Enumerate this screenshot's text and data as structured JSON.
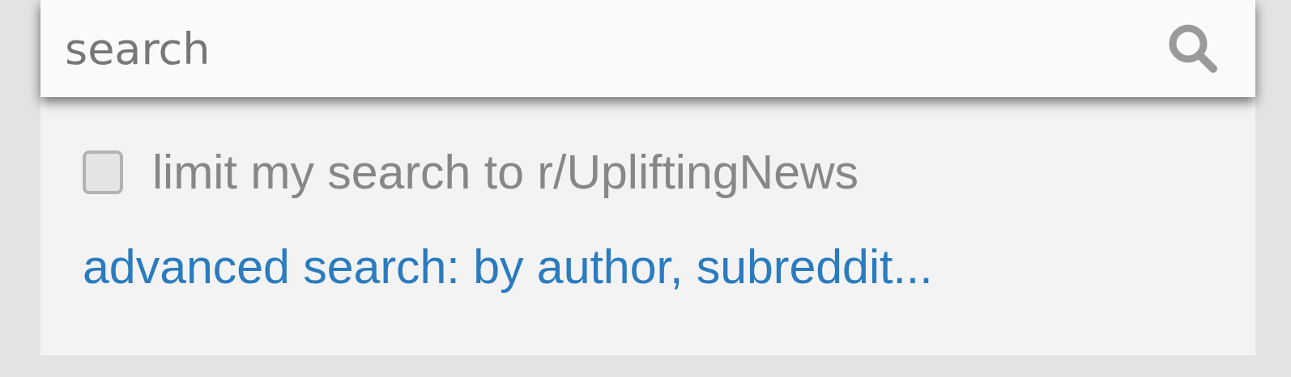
{
  "search": {
    "placeholder": "search"
  },
  "options": [
    {
      "kind": "checkbox",
      "label": "limit my search to r/UpliftingNews",
      "checked": false
    }
  ],
  "advanced_link": "advanced search: by author, subreddit..."
}
